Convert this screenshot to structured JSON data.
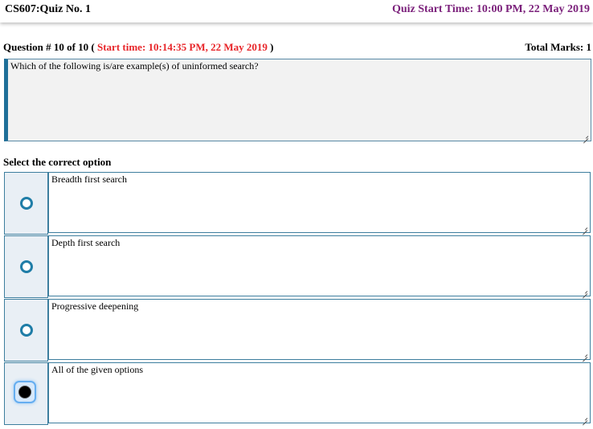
{
  "header": {
    "quiz_title": "CS607:Quiz No. 1",
    "quiz_start_time": "Quiz Start Time: 10:00 PM, 22 May 2019"
  },
  "question": {
    "number_text": "Question # 10 of 10 (",
    "start_time": "Start time: 10:14:35 PM, 22 May 2019",
    "close_paren": ")",
    "total_marks": "Total Marks: 1",
    "text": "Which of the following is/are example(s) of uninformed search?"
  },
  "select_label": "Select the correct option",
  "options": [
    {
      "text": "Breadth first search",
      "selected": false
    },
    {
      "text": "Depth first search",
      "selected": false
    },
    {
      "text": "Progressive deepening",
      "selected": false
    },
    {
      "text": "All of the given options",
      "selected": true
    }
  ],
  "colors": {
    "quiz_start_time": "#7a1f7a",
    "question_start_time": "#e8262a",
    "border_accent": "#1f6f98",
    "radio": "#1f7da7"
  }
}
